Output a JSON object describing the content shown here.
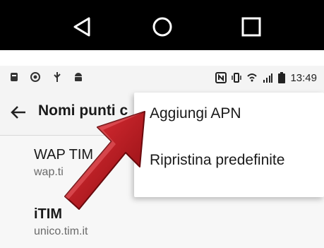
{
  "navbar": {
    "back_icon": "triangle-back-icon",
    "home_icon": "circle-home-icon",
    "recents_icon": "square-recents-icon"
  },
  "statusbar": {
    "time": "13:49",
    "left_icons": [
      "app-notification-icon",
      "eye-icon",
      "usb-icon",
      "android-icon"
    ],
    "right_icons": [
      "nfc-icon",
      "vibrate-icon",
      "wifi-icon",
      "signal-icon",
      "battery-icon"
    ]
  },
  "appbar": {
    "title": "Nomi punti c"
  },
  "apn_list": [
    {
      "name": "WAP TIM",
      "sub": "wap.ti"
    },
    {
      "name": "iTIM",
      "sub": "unico.tim.it"
    }
  ],
  "menu": {
    "items": [
      {
        "label": "Aggiungi APN"
      },
      {
        "label": "Ripristina predefinite"
      }
    ]
  },
  "colors": {
    "navbar_bg": "#000000",
    "appbar_bg": "#f4f4f4",
    "arrow_red": "#c8141b"
  }
}
